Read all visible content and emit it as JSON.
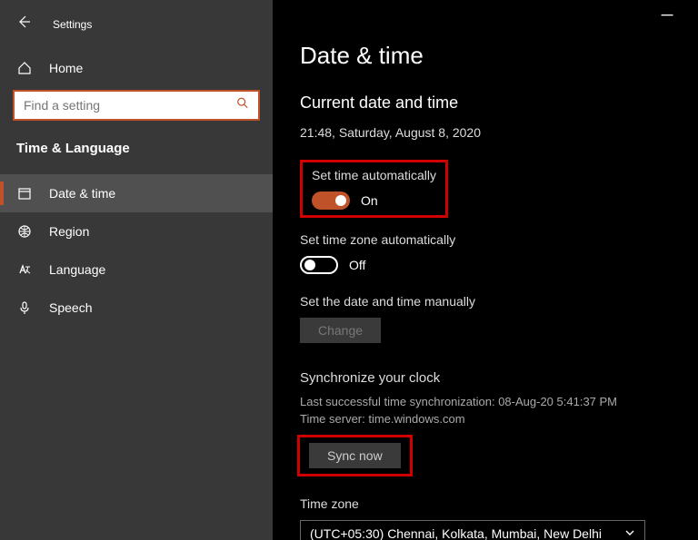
{
  "titlebar": {
    "app_title": "Settings"
  },
  "sidebar": {
    "home_label": "Home",
    "search_placeholder": "Find a setting",
    "category": "Time & Language",
    "items": [
      {
        "label": "Date & time"
      },
      {
        "label": "Region"
      },
      {
        "label": "Language"
      },
      {
        "label": "Speech"
      }
    ]
  },
  "main": {
    "heading": "Date & time",
    "current_section_title": "Current date and time",
    "current_value": "21:48, Saturday, August 8, 2020",
    "auto_time": {
      "label": "Set time automatically",
      "state_text": "On"
    },
    "auto_tz": {
      "label": "Set time zone automatically",
      "state_text": "Off"
    },
    "manual": {
      "label": "Set the date and time manually",
      "button": "Change"
    },
    "sync": {
      "heading": "Synchronize your clock",
      "last_sync": "Last successful time synchronization: 08-Aug-20 5:41:37 PM",
      "server": "Time server: time.windows.com",
      "button": "Sync now"
    },
    "timezone": {
      "label": "Time zone",
      "selected": "(UTC+05:30) Chennai, Kolkata, Mumbai, New Delhi"
    }
  }
}
